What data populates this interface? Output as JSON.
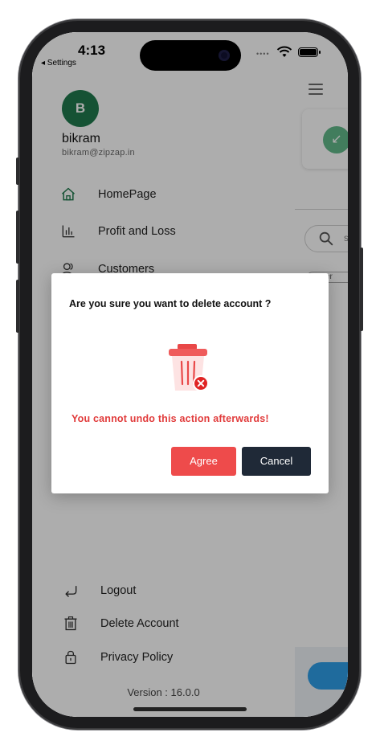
{
  "status_bar": {
    "time": "4:13",
    "back_label": "◂ Settings",
    "signal_dots": "••••"
  },
  "background": {
    "peek_search_letter": "s",
    "peek_tab_label": "omer"
  },
  "drawer": {
    "avatar_initial": "B",
    "user_name": "bikram",
    "user_email": "bikram@zipzap.in",
    "nav_items": [
      {
        "label": "HomePage",
        "icon": "home-icon"
      },
      {
        "label": "Profit and Loss",
        "icon": "bar-chart-icon"
      },
      {
        "label": "Customers",
        "icon": "customers-icon"
      }
    ],
    "bottom_items": [
      {
        "label": "Logout",
        "icon": "logout-icon"
      },
      {
        "label": "Delete Account",
        "icon": "trash-icon"
      },
      {
        "label": "Privacy Policy",
        "icon": "lock-icon"
      }
    ],
    "version": "Version : 16.0.0",
    "accent_color": "#1f7a4d"
  },
  "modal": {
    "title": "Are you sure you want to delete account ?",
    "illustration": "trash-icon",
    "warning": "You cannot undo this action afterwards!",
    "agree_label": "Agree",
    "cancel_label": "Cancel",
    "agree_color": "#ee4b4b",
    "cancel_color": "#1f2937",
    "warning_color": "#e13b3b"
  }
}
